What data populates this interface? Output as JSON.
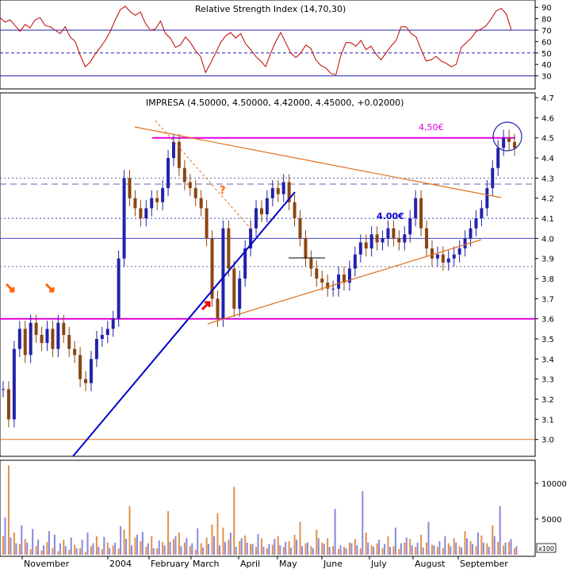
{
  "chart_data": [
    {
      "type": "line",
      "panel": "indicator",
      "title": "Relative Strength Index (14,70,30)",
      "ylim": [
        20,
        95
      ],
      "yticks": [
        30,
        40,
        50,
        60,
        70,
        80,
        90
      ],
      "reference_lines": [
        {
          "y": 70,
          "style": "solid",
          "color": "#2222aa"
        },
        {
          "y": 50,
          "style": "dashed",
          "color": "#2222aa"
        },
        {
          "y": 30,
          "style": "solid",
          "color": "#2222aa"
        }
      ],
      "series": [
        {
          "color": "#c00000",
          "values": [
            81,
            77,
            79,
            74,
            69,
            75,
            72,
            79,
            81,
            74,
            73,
            70,
            67,
            73,
            64,
            60,
            48,
            38,
            42,
            49,
            55,
            61,
            69,
            79,
            88,
            91,
            86,
            83,
            86,
            76,
            70,
            71,
            78,
            67,
            63,
            55,
            57,
            64,
            59,
            52,
            47,
            33,
            41,
            50,
            59,
            65,
            68,
            63,
            67,
            58,
            53,
            47,
            43,
            38,
            50,
            60,
            68,
            59,
            50,
            46,
            50,
            57,
            54,
            44,
            39,
            37,
            32,
            31,
            48,
            59,
            59,
            56,
            61,
            53,
            56,
            49,
            44,
            50,
            56,
            61,
            73,
            73,
            67,
            64,
            53,
            43,
            44,
            47,
            43,
            41,
            38,
            40,
            55,
            59,
            63,
            69,
            71,
            74,
            80,
            87,
            89,
            84,
            70
          ]
        }
      ]
    },
    {
      "type": "candlestick",
      "panel": "price",
      "title": "IMPRESA (4.50000, 4.50000, 4.42000, 4.45000, +0.02000)",
      "ylim": [
        2.92,
        4.72
      ],
      "yticks": [
        3.0,
        3.1,
        3.2,
        3.3,
        3.4,
        3.5,
        3.6,
        3.7,
        3.8,
        3.9,
        4.0,
        4.1,
        4.2,
        4.3,
        4.4,
        4.5,
        4.6,
        4.7
      ],
      "x_labels": [
        "November",
        "2004",
        "February",
        "March",
        "April",
        "May",
        "June",
        "July",
        "August",
        "September"
      ],
      "close": [
        3.25,
        3.1,
        3.45,
        3.55,
        3.42,
        3.58,
        3.52,
        3.48,
        3.55,
        3.45,
        3.58,
        3.52,
        3.45,
        3.42,
        3.3,
        3.28,
        3.4,
        3.5,
        3.52,
        3.55,
        3.6,
        3.9,
        4.3,
        4.2,
        4.15,
        4.1,
        4.15,
        4.2,
        4.18,
        4.25,
        4.4,
        4.48,
        4.35,
        4.28,
        4.25,
        4.2,
        4.15,
        4.0,
        3.7,
        3.6,
        4.05,
        3.85,
        3.65,
        3.8,
        3.95,
        4.05,
        4.15,
        4.12,
        4.2,
        4.25,
        4.22,
        4.28,
        4.18,
        4.1,
        4.0,
        3.9,
        3.85,
        3.8,
        3.78,
        3.75,
        3.75,
        3.82,
        3.78,
        3.85,
        3.92,
        3.98,
        3.95,
        4.02,
        3.98,
        4.0,
        4.05,
        4.0,
        3.98,
        4.02,
        4.1,
        4.2,
        4.05,
        3.95,
        3.9,
        3.92,
        3.88,
        3.9,
        3.92,
        3.95,
        4.0,
        4.05,
        4.1,
        4.15,
        4.25,
        4.35,
        4.45,
        4.5,
        4.48,
        4.45
      ],
      "annotations": [
        {
          "text": "4,50€",
          "type": "label",
          "color": "#e000e0"
        },
        {
          "text": "4.00€",
          "type": "label",
          "color": "#0000cc"
        },
        {
          "text": "?",
          "type": "label",
          "color": "#ff6600"
        },
        {
          "type": "horizontal",
          "y": 4.5,
          "color": "#e000e0"
        },
        {
          "type": "horizontal",
          "y": 3.6,
          "color": "#e000e0"
        },
        {
          "type": "horizontal",
          "y": 3.0,
          "color": "#e07020"
        },
        {
          "type": "horizontal",
          "y": 4.0,
          "color": "#4444cc"
        },
        {
          "type": "horizontal",
          "y": 4.27,
          "color": "#6666aa",
          "style": "dashed"
        },
        {
          "type": "horizontal",
          "y": 4.3,
          "color": "#6666aa",
          "style": "dotted"
        },
        {
          "type": "horizontal",
          "y": 4.1,
          "color": "#4444cc",
          "style": "dotted"
        },
        {
          "type": "horizontal",
          "y": 3.86,
          "color": "#6666aa",
          "style": "dotted"
        }
      ]
    },
    {
      "type": "bar",
      "panel": "volume",
      "ylim": [
        0,
        13000
      ],
      "yticks": [
        5000,
        10000
      ],
      "unit_label": "x100",
      "series": [
        {
          "color": "#e0904a",
          "values": [
            2600,
            12500,
            3100,
            1500,
            2200,
            800,
            1200,
            600,
            1800,
            900,
            500,
            2100,
            700,
            1400,
            900,
            400,
            1200,
            2600,
            800,
            1700,
            1300,
            900,
            3500,
            6800,
            2400,
            1900,
            1100,
            2600,
            900,
            1800,
            6100,
            2200,
            3100,
            1700,
            1200,
            700,
            1600,
            2400,
            4200,
            5800,
            3800,
            2100,
            9500,
            1900,
            2700,
            1500,
            1100,
            2300,
            900,
            1400,
            2600,
            1100,
            1900,
            2800,
            4600,
            1600,
            1200,
            3500,
            1700,
            2300,
            1200,
            800,
            1100,
            1700,
            2200,
            900,
            3100,
            1300,
            1600,
            900,
            2600,
            1200,
            800,
            1700,
            2200,
            1100,
            2800,
            1700,
            1400,
            1100,
            900,
            1600,
            2300,
            1200,
            3300,
            1900,
            1200,
            2700,
            1600,
            4100,
            1800,
            1300,
            1800,
            900
          ]
        },
        {
          "color": "#8888dd",
          "values": [
            5200,
            2400,
            1600,
            4100,
            1700,
            3600,
            2100,
            1300,
            3300,
            2800,
            1600,
            1200,
            2400,
            900,
            2100,
            3100,
            1600,
            1100,
            2500,
            900,
            1700,
            4000,
            2200,
            1300,
            2800,
            3200,
            1600,
            900,
            2000,
            1300,
            1800,
            2600,
            1200,
            2300,
            1600,
            3700,
            1000,
            1500,
            2600,
            1300,
            1800,
            3100,
            1100,
            2300,
            1700,
            1500,
            2900,
            1100,
            1500,
            2200,
            1300,
            1800,
            1000,
            2100,
            1200,
            1700,
            900,
            2300,
            1500,
            1100,
            6400,
            1300,
            900,
            1600,
            1300,
            8900,
            1700,
            1100,
            2100,
            1500,
            1100,
            3800,
            1600,
            2400,
            1300,
            1700,
            1000,
            4600,
            1300,
            1900,
            2600,
            1200,
            1700,
            1000,
            2300,
            1500,
            3100,
            1700,
            1100,
            2600,
            6800,
            1700,
            2200,
            1200
          ]
        }
      ]
    }
  ]
}
